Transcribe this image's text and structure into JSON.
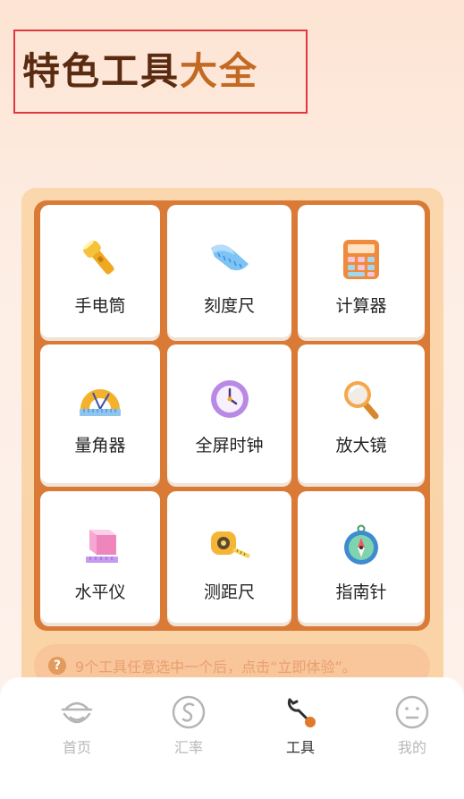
{
  "header": {
    "title_part1": "特色工具",
    "title_part2": "大全"
  },
  "tools": [
    {
      "label": "手电筒",
      "icon": "flashlight-icon"
    },
    {
      "label": "刻度尺",
      "icon": "ruler-icon"
    },
    {
      "label": "计算器",
      "icon": "calculator-icon"
    },
    {
      "label": "量角器",
      "icon": "protractor-icon"
    },
    {
      "label": "全屏时钟",
      "icon": "clock-icon"
    },
    {
      "label": "放大镜",
      "icon": "magnifier-icon"
    },
    {
      "label": "水平仪",
      "icon": "level-icon"
    },
    {
      "label": "测距尺",
      "icon": "tape-measure-icon"
    },
    {
      "label": "指南针",
      "icon": "compass-icon"
    }
  ],
  "tip": {
    "icon": "question-icon",
    "mark": "?",
    "text": "9个工具任意选中一个后，点击“立即体验”。"
  },
  "tabs": [
    {
      "label": "首页",
      "icon": "home-icon",
      "active": false
    },
    {
      "label": "汇率",
      "icon": "exchange-rate-icon",
      "active": false
    },
    {
      "label": "工具",
      "icon": "wrench-icon",
      "active": true
    },
    {
      "label": "我的",
      "icon": "profile-icon",
      "active": false
    }
  ]
}
